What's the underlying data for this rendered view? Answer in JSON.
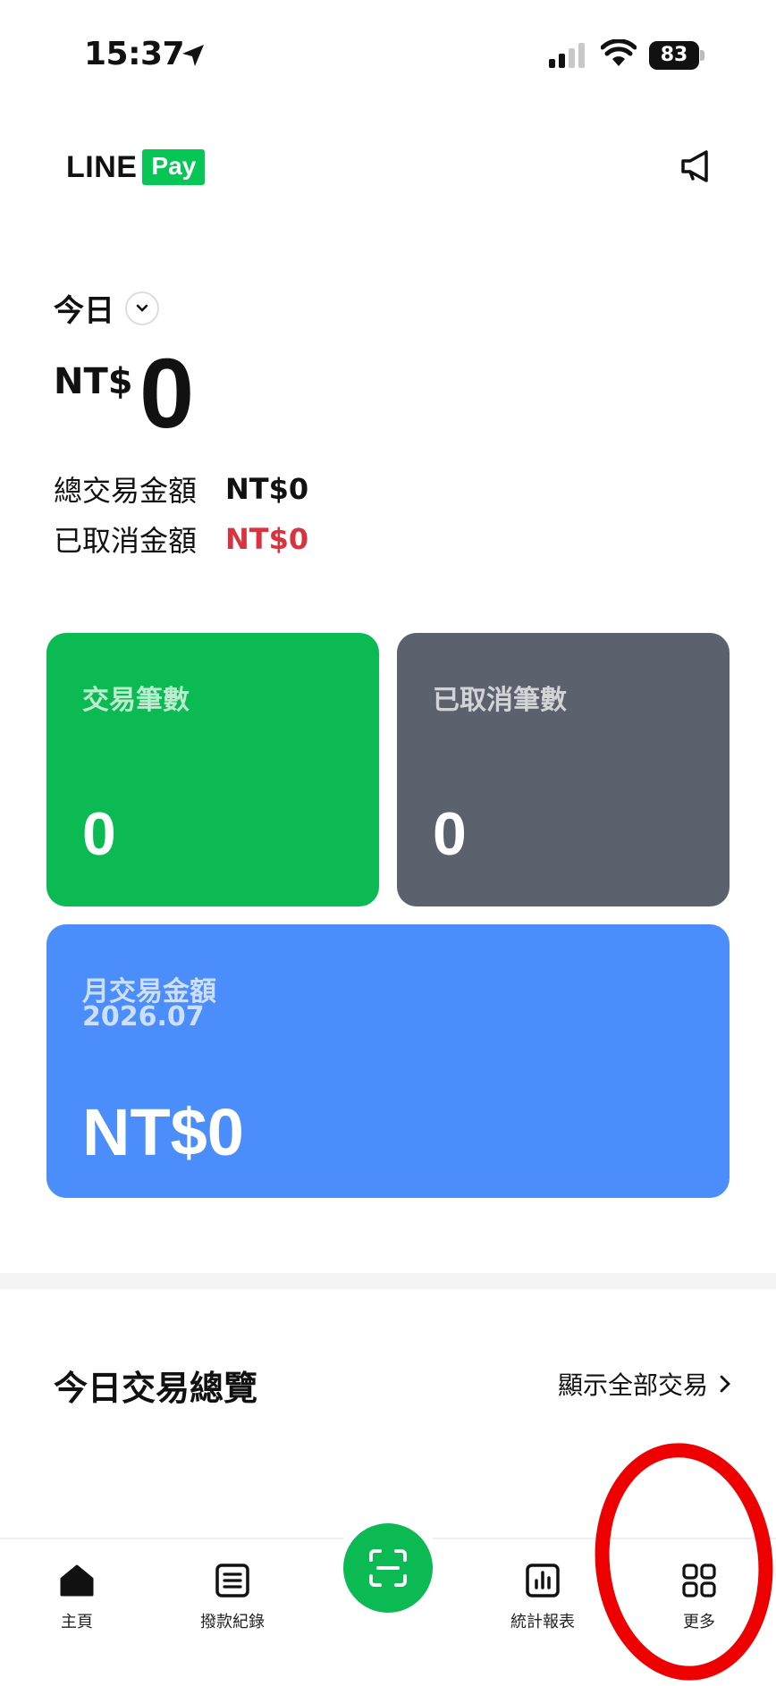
{
  "status_bar": {
    "time": "15:37",
    "battery": "83"
  },
  "header": {
    "logo_line": "LINE",
    "logo_pay": "Pay",
    "brand_color": "#06c755"
  },
  "summary": {
    "period": "今日",
    "currency": "NT$",
    "amount": "0",
    "total_label": "總交易金額",
    "total_value": "NT$0",
    "cancelled_label": "已取消金額",
    "cancelled_value": "NT$0",
    "cancelled_color": "#d8333e"
  },
  "cards": {
    "transactions": {
      "title": "交易筆數",
      "value": "0",
      "color": "#0bba52"
    },
    "cancelled": {
      "title": "已取消筆數",
      "value": "0",
      "color": "#5b616d"
    },
    "monthly": {
      "title": "月交易金額",
      "month": "2026.07",
      "value": "NT$0",
      "color": "#4b8dfa"
    }
  },
  "overview": {
    "title": "今日交易總覽",
    "link": "顯示全部交易"
  },
  "bottom_nav": {
    "items": [
      {
        "label": "主頁",
        "icon": "home-icon"
      },
      {
        "label": "撥款紀錄",
        "icon": "list-icon"
      },
      {
        "label": "",
        "icon": "scan-icon"
      },
      {
        "label": "統計報表",
        "icon": "chart-icon"
      },
      {
        "label": "更多",
        "icon": "grid-icon"
      }
    ]
  },
  "annotation_color": "#ee0000"
}
